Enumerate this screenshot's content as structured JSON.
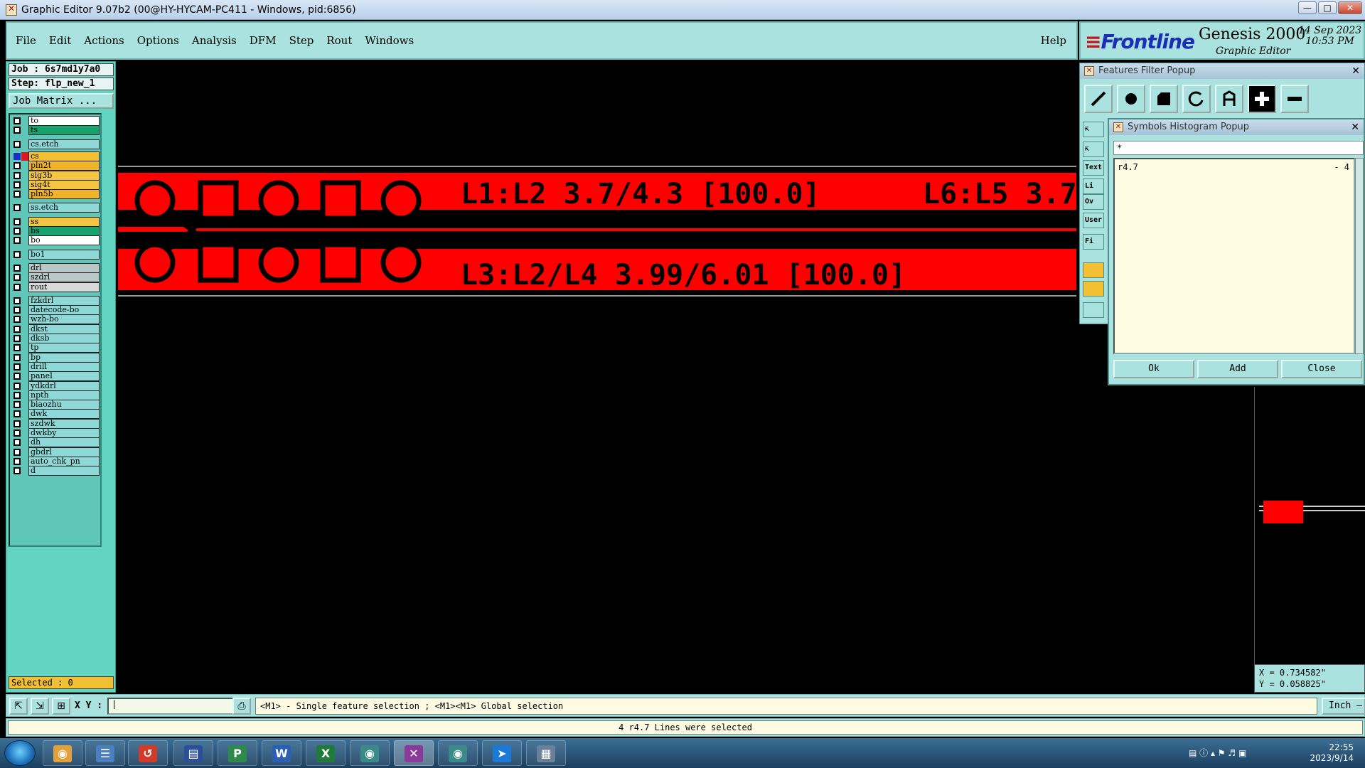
{
  "window": {
    "title": "Graphic Editor 9.07b2 (00@HY-HYCAM-PC411 - Windows, pid:6856)"
  },
  "menu": {
    "items": [
      "File",
      "Edit",
      "Actions",
      "Options",
      "Analysis",
      "DFM",
      "Step",
      "Rout",
      "Windows"
    ],
    "help": "Help"
  },
  "brand": {
    "logo": "Frontline",
    "product": "Genesis 2000",
    "subtitle": "Graphic Editor",
    "date": "14 Sep 2023",
    "time": "10:53 PM"
  },
  "job": {
    "job_label": "Job  : 6s7md1y7a0",
    "step_label": "Step: flp_new_1",
    "matrix_button": "Job Matrix ...",
    "selected": "Selected : 0"
  },
  "layers": [
    {
      "name": "to",
      "color": "white"
    },
    {
      "name": "ts",
      "color": "green"
    },
    {
      "name": "cs.etch",
      "color": "teal"
    },
    {
      "name": "cs",
      "color": "yellow",
      "active": true
    },
    {
      "name": "pln2t",
      "color": "orange"
    },
    {
      "name": "sig3b",
      "color": "yellow"
    },
    {
      "name": "sig4t",
      "color": "yellow"
    },
    {
      "name": "pln5b",
      "color": "orange"
    },
    {
      "name": "ss.etch",
      "color": "teal"
    },
    {
      "name": "ss",
      "color": "yellow"
    },
    {
      "name": "bs",
      "color": "green"
    },
    {
      "name": "bo",
      "color": "white"
    },
    {
      "name": "bo1",
      "color": "teal"
    },
    {
      "name": "drl",
      "color": "gray"
    },
    {
      "name": "szdrl",
      "color": "gray"
    },
    {
      "name": "rout",
      "color": "light"
    },
    {
      "name": "fzkdrl",
      "color": "teal"
    },
    {
      "name": "datecode-bo",
      "color": "teal"
    },
    {
      "name": "wzh-bo",
      "color": "teal"
    },
    {
      "name": "dkst",
      "color": "teal"
    },
    {
      "name": "dksb",
      "color": "teal"
    },
    {
      "name": "tp",
      "color": "teal"
    },
    {
      "name": "bp",
      "color": "teal"
    },
    {
      "name": "drill",
      "color": "teal"
    },
    {
      "name": "panel",
      "color": "teal"
    },
    {
      "name": "ydkdrl",
      "color": "teal"
    },
    {
      "name": "npth",
      "color": "teal"
    },
    {
      "name": "biaozhu",
      "color": "teal"
    },
    {
      "name": "dwk",
      "color": "teal"
    },
    {
      "name": "szdwk",
      "color": "teal"
    },
    {
      "name": "dwkby",
      "color": "teal"
    },
    {
      "name": "dh",
      "color": "teal"
    },
    {
      "name": "gbdrl",
      "color": "teal"
    },
    {
      "name": "auto_chk_pn",
      "color": "teal"
    },
    {
      "name": "d",
      "color": "teal"
    }
  ],
  "canvas": {
    "label_top_left": "L1:L2 3.7/4.3 [100.0]",
    "label_top_right": "L6:L5 3.7/",
    "label_bottom": "L3:L2/L4 3.99/6.01 [100.0]",
    "copper_color": "#ff0000"
  },
  "features_popup": {
    "title": "Features Filter Popup",
    "side_labels": [
      "Text",
      "Li",
      "Ov",
      "User",
      "Fi"
    ]
  },
  "histogram_popup": {
    "title": "Symbols Histogram Popup",
    "filter_value": "*",
    "rows": [
      {
        "symbol": "r4.7",
        "count": "- 4"
      }
    ],
    "ok": "Ok",
    "add": "Add",
    "close": "Close"
  },
  "coords": {
    "x": "X = 0.734582\"",
    "y": "Y = 0.058825\""
  },
  "command": {
    "xy_label": "X Y :",
    "hint": "<M1> - Single feature selection ; <M1><M1> Global selection",
    "unit": "Inch",
    "status": "4 r4.7 Lines were selected"
  },
  "taskbar": {
    "time": "22:55",
    "date": "2023/9/14"
  }
}
